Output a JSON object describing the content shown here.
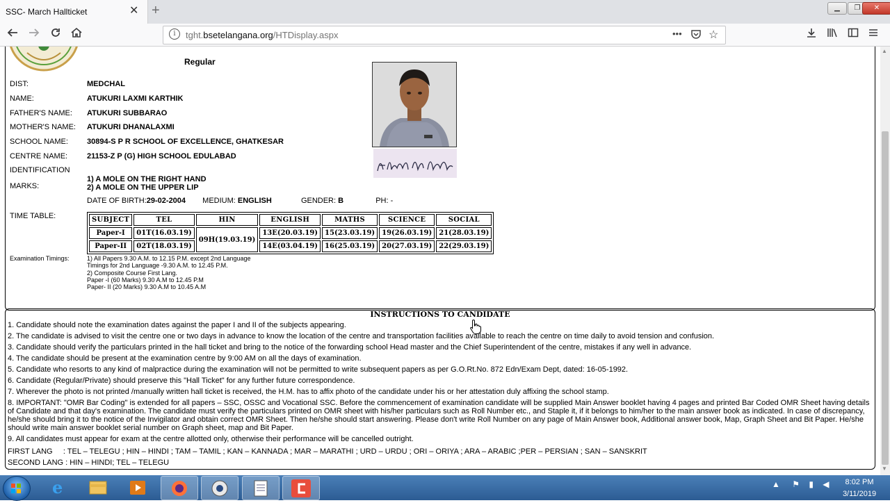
{
  "browser": {
    "tab_title": "SSC- March Hallticket",
    "tab_close": "✕",
    "new_tab": "+",
    "url_prefix": "tght.",
    "url_host": "bsetelangana.org",
    "url_path": "/HTDisplay.aspx",
    "page_actions": "•••"
  },
  "header": {
    "type": "Regular"
  },
  "candidate": {
    "dist_label": "DIST:",
    "dist": "MEDCHAL",
    "name_label": "NAME:",
    "name": "ATUKURI LAXMI KARTHIK",
    "father_label": "FATHER'S NAME:",
    "father": "ATUKURI SUBBARAO",
    "mother_label": "MOTHER'S NAME:",
    "mother": "ATUKURI DHANALAXMI",
    "school_label": "SCHOOL NAME:",
    "school": "30894-S P R SCHOOL OF EXCELLENCE, GHATKESAR",
    "centre_label": "CENTRE NAME:",
    "centre": "21153-Z P (G) HIGH SCHOOL EDULABAD",
    "identification_label": "IDENTIFICATION",
    "marks_label": "MARKS:",
    "mark1": "1) A MOLE ON THE RIGHT HAND",
    "mark2": "2) A MOLE ON THE UPPER LIP",
    "dob_label": "DATE OF BIRTH:",
    "dob": "29-02-2004",
    "medium_label": "MEDIUM:",
    "medium": "ENGLISH",
    "gender_label": "GENDER:",
    "gender": "B",
    "ph_label": "PH:",
    "ph": "-",
    "signature_text": "A. Lakshmi Karthik"
  },
  "timetable": {
    "label": "TIME TABLE:",
    "headers": [
      "SUBJECT",
      "TEL",
      "HIN",
      "ENGLISH",
      "MATHS",
      "SCIENCE",
      "SOCIAL"
    ],
    "paper1": [
      "Paper-I",
      "01T(16.03.19)",
      "09H(19.03.19)",
      "13E(20.03.19)",
      "15(23.03.19)",
      "19(26.03.19)",
      "21(28.03.19)"
    ],
    "paper2": [
      "Paper-II",
      "02T(18.03.19)",
      "14E(03.04.19)",
      "16(25.03.19)",
      "20(27.03.19)",
      "22(29.03.19)"
    ]
  },
  "timings": {
    "label": "Examination Timings:",
    "lines": [
      "1) All Papers 9.30 A.M. to 12.15 P.M. except 2nd Language",
      "Timings for 2nd Language -9.30 A.M. to 12.45 P.M.",
      "2) Composite Course First Lang.",
      "Paper -I (60 Marks) 9.30 A.M to 12.45 P.M",
      "Paper- II (20 Marks) 9.30 A.M to 10.45 A.M"
    ]
  },
  "instructions": {
    "title": "INSTRUCTIONS TO CANDIDATE",
    "items": [
      "1. Candidate should note the examination  dates against the paper I and II of the subjects appearing.",
      "2. The candidate is advised to visit the centre one or two days in advance to know the location of the centre and transportation facilities available to reach the centre on time daily to avoid tension and confusion.",
      "3. Candidate should verify the particulars printed in the hall ticket and bring to the notice of the forwarding school Head master and the Chief Superintendent of the centre, mistakes if any well in advance.",
      "4. The candidate should be present at the examination centre by 9:00 AM on all the days of examination.",
      "5. Candidate who resorts to any kind of malpractice during the examination will not be permitted to write subsequent papers as per G.O.Rt.No. 872 Edn/Exam Dept, dated: 16-05-1992.",
      "6. Candidate (Regular/Private) should preserve this \"Hall Ticket\" for any further future correspondence.",
      "7. Wherever the photo is not printed /manually written hall ticket is received, the H.M. has to affix photo of the candidate under his or her attestation duly affixing the school stamp.",
      "8. IMPORTANT: \"OMR Bar Coding\" is extended for all papers – SSC, OSSC and Vocational SSC. Before the commencement of examination candidate will be supplied Main Answer booklet having 4 pages and printed Bar Coded OMR Sheet having details of Candidate and that day's examination. The candidate must verify the particulars printed on OMR sheet with his/her particulars such as Roll Number etc., and Staple it, if it belongs to him/her to the main answer book as indicated. In case of discrepancy, he/she should bring it to the notice of the Invigilator and obtain correct OMR Sheet. Then he/she should start answering. Please don't write Roll Number on any page of Main Answer book, Additional answer book, Map, Graph Sheet and Bit Paper. He/she should write main answer booklet serial number on Graph sheet, map and Bit Paper.",
      "9. All candidates must appear for exam at the centre allotted only, otherwise their performance will be cancelled outright."
    ],
    "first_lang": "FIRST LANG     : TEL – TELEGU ; HIN – HINDI ; TAM – TAMIL ; KAN – KANNADA ; MAR – MARATHI ; URD – URDU ; ORI – ORIYA ; ARA – ARABIC ;PER – PERSIAN ; SAN – SANSKRIT",
    "second_lang": "SECOND LANG : HIN – HINDI; TEL – TELEGU"
  },
  "taskbar": {
    "time": "8:02 PM",
    "date": "3/11/2019"
  },
  "colors": {
    "taskbar": "#2c5c93",
    "firefox_orange": "#ff7139"
  }
}
